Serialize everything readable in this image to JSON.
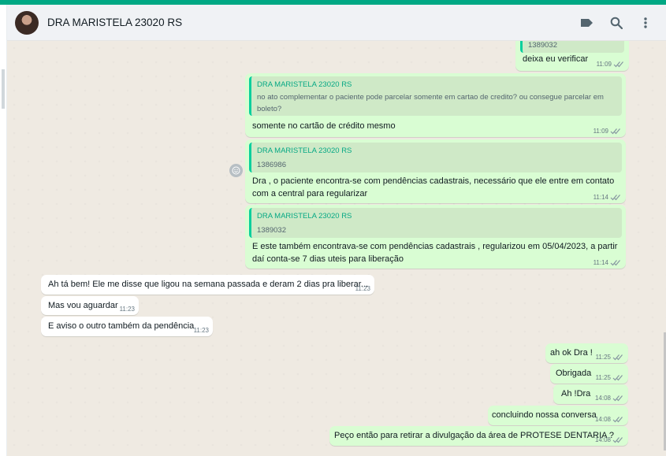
{
  "header": {
    "contact_name": "DRA MARISTELA 23020 RS",
    "icons": [
      "label-icon",
      "search-icon",
      "menu-icon"
    ]
  },
  "colors": {
    "accent": "#00a884",
    "outgoing": "#d9fdd3",
    "incoming": "#ffffff",
    "quote_name": "#06a884"
  },
  "messages": [
    {
      "dir": "out",
      "partial_quote": "1389032",
      "text": "deixa eu verificar",
      "time": "11:09"
    },
    {
      "dir": "out",
      "quote_author": "DRA MARISTELA 23020 RS",
      "quote_text": "no ato complementar o paciente pode parcelar somente em cartao de credito? ou consegue parcelar em boleto?",
      "text": "somente no cartão de crédito mesmo",
      "time": "11:09"
    },
    {
      "dir": "out",
      "quote_author": "DRA MARISTELA 23020 RS",
      "quote_text": "1386986",
      "text": "Dra , o paciente encontra-se com pendências cadastrais, necessário que ele entre em contato com a central para regularizar",
      "time": "11:14"
    },
    {
      "dir": "out",
      "quote_author": "DRA MARISTELA 23020 RS",
      "quote_text": "1389032",
      "text": "E este também encontrava-se com pendências cadastrais , regularizou em 05/04/2023, a partir daí conta-se 7 dias uteis para liberação",
      "time": "11:14"
    },
    {
      "dir": "in",
      "text": "Ah tá bem! Ele me disse que ligou na semana passada e deram 2 dias pra liberar...",
      "time": "11:23"
    },
    {
      "dir": "in",
      "text": "Mas vou aguardar",
      "time": "11:23"
    },
    {
      "dir": "in",
      "text": "E aviso o outro também da pendência",
      "time": "11:23"
    },
    {
      "dir": "out",
      "text": "ah ok Dra !",
      "time": "11:25"
    },
    {
      "dir": "out",
      "text": "Obrigada",
      "time": "11:25"
    },
    {
      "dir": "out",
      "text": "Ah !Dra",
      "time": "14:08"
    },
    {
      "dir": "out",
      "text": "concluindo nossa conversa",
      "time": "14:08"
    },
    {
      "dir": "out",
      "text": "Peço então para retirar a divulgação da área de PROTESE DENTARIA ?",
      "time": "14:08"
    }
  ]
}
